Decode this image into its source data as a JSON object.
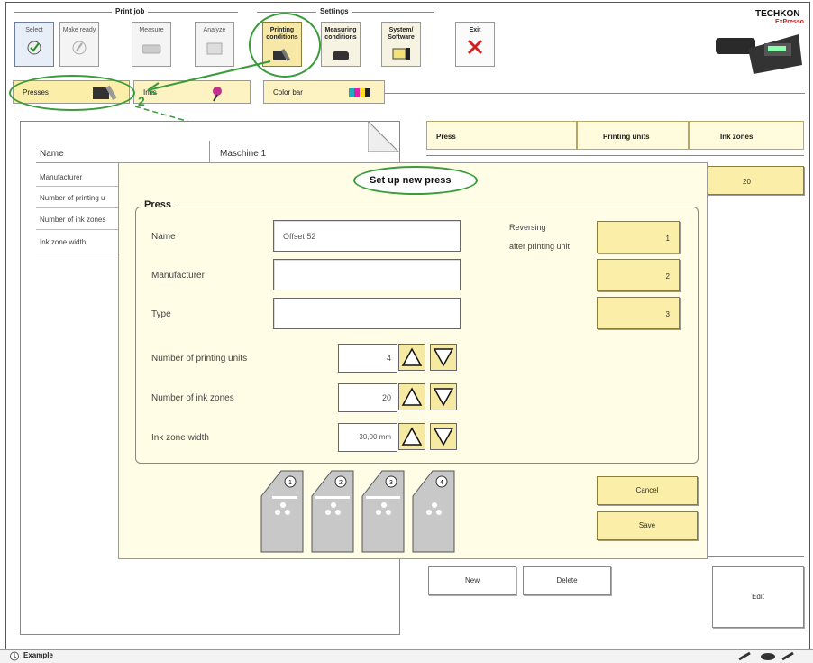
{
  "toolbar": {
    "group_printjob": "Print job",
    "group_settings": "Settings",
    "buttons": [
      {
        "label": "Select",
        "icon": "select-icon"
      },
      {
        "label": "Make ready",
        "icon": "make-ready-icon"
      },
      {
        "label": "Measure",
        "icon": "measure-icon"
      },
      {
        "label": "Analyze",
        "icon": "analyze-icon"
      },
      {
        "label": "Printing conditions",
        "icon": "printing-conditions-icon"
      },
      {
        "label": "Measuring conditions",
        "icon": "measuring-conditions-icon"
      },
      {
        "label": "System/ Software",
        "icon": "system-software-icon"
      },
      {
        "label": "Exit",
        "icon": "exit-x-icon"
      }
    ]
  },
  "brand": {
    "name": "TECHKON",
    "product": "ExPresso"
  },
  "tabs": {
    "presses": "Presses",
    "inks": "Inks",
    "colorbar": "Color bar"
  },
  "annotation": {
    "step_number": "2",
    "callout": "Set up new press"
  },
  "sheet": {
    "name_header": "Name",
    "machine_header": "Maschine 1",
    "rows": [
      "Manufacturer",
      "Number of printing u",
      "Number of ink zones",
      "Ink zone width"
    ]
  },
  "press_table": {
    "headers": [
      "Press",
      "Printing units",
      "Ink zones"
    ],
    "zones_value": "20"
  },
  "dialog": {
    "legend": "Press",
    "name_label": "Name",
    "name_value": "Offset 52",
    "manufacturer_label": "Manufacturer",
    "manufacturer_value": "",
    "type_label": "Type",
    "type_value": "",
    "units_label": "Number of printing units",
    "units_value": "4",
    "zones_label": "Number of ink zones",
    "zones_value": "20",
    "width_label": "Ink zone width",
    "width_value": "30,00 mm",
    "reversing_label_1": "Reversing",
    "reversing_label_2": "after printing unit",
    "reversing_buttons": [
      "1",
      "2",
      "3"
    ],
    "units": [
      "1",
      "2",
      "3",
      "4"
    ],
    "cancel": "Cancel",
    "save": "Save"
  },
  "bottom": {
    "new": "New",
    "delete": "Delete",
    "edit": "Edit"
  },
  "status": {
    "label": "Example"
  },
  "colors": {
    "yellow": "#fbeea8",
    "green": "#3a9b3a",
    "red": "#d22020"
  }
}
